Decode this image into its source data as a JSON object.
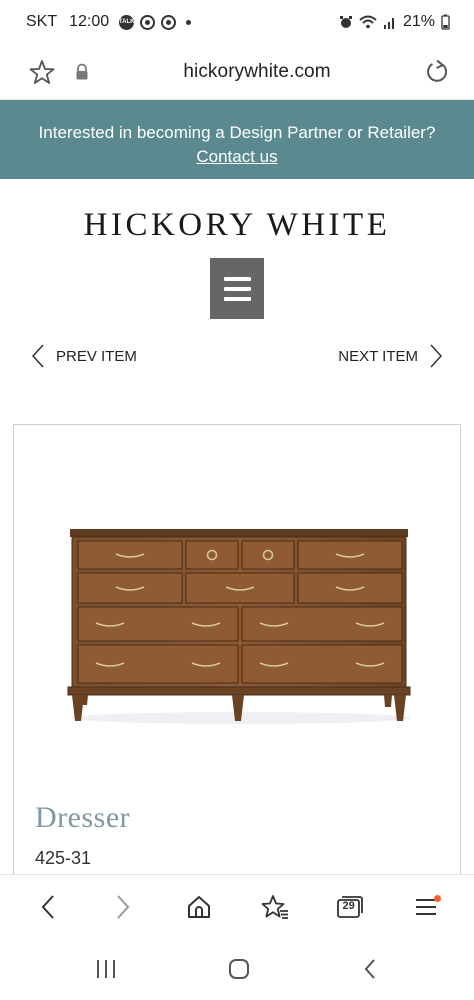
{
  "status_bar": {
    "carrier": "SKT",
    "time": "12:00",
    "talk_badge": "TALK",
    "battery": "21%"
  },
  "address_bar": {
    "url": "hickorywhite.com"
  },
  "banner": {
    "text": "Interested in becoming a Design Partner or Retailer?",
    "link": "Contact us",
    "color": "#5a8a8f"
  },
  "site": {
    "logo": "HICKORY WHITE"
  },
  "item_nav": {
    "prev_label": "PREV ITEM",
    "next_label": "NEXT ITEM"
  },
  "product": {
    "title": "Dresser",
    "sku": "425-31"
  },
  "browser_toolbar": {
    "tab_count": "29",
    "accent": "#f0642a"
  },
  "icons": [
    "star-icon",
    "lock-icon",
    "reload-icon",
    "hamburger-menu-icon",
    "chevron-left-icon",
    "chevron-right-icon",
    "back-icon",
    "forward-icon",
    "home-icon",
    "bookmarks-icon",
    "tabs-icon",
    "menu-icon",
    "recent-apps-icon",
    "home-button-icon",
    "back-button-icon"
  ]
}
